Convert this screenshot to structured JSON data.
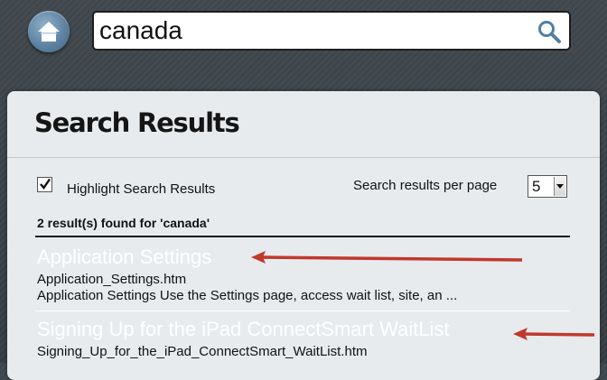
{
  "header": {
    "home_icon": "home-icon",
    "search": {
      "value": "canada",
      "icon": "search-icon"
    }
  },
  "panel": {
    "title": "Search Results",
    "highlight": {
      "label": "Highlight Search Results",
      "checked": true
    },
    "per_page": {
      "label": "Search results per page",
      "value": "5"
    },
    "count_text": "2 result(s) found for 'canada'",
    "results": [
      {
        "title": "Application Settings",
        "file": "Application_Settings.htm",
        "snippet": "Application Settings Use the Settings page, access wait list, site, an ..."
      },
      {
        "title": "Signing Up for the iPad ConnectSmart WaitList",
        "file": "Signing_Up_for_the_iPad_ConnectSmart_WaitList.htm"
      }
    ]
  },
  "colors": {
    "annotation_arrow": "#c0392b",
    "panel_bg": "#e7ebee",
    "result_title": "#ffffff"
  }
}
